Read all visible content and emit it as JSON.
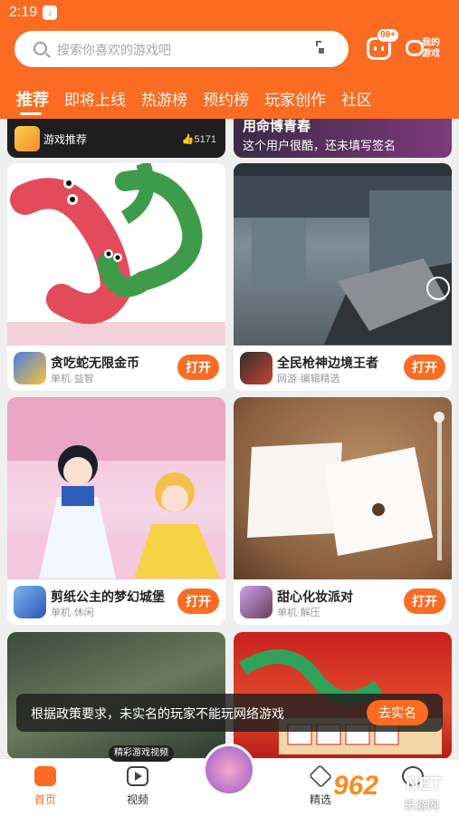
{
  "status": {
    "time": "2:19"
  },
  "search": {
    "placeholder": "搜索你喜欢的游戏吧"
  },
  "header": {
    "message_badge": "99+",
    "my_games_label": "我的游戏"
  },
  "tabs": [
    {
      "label": "推荐",
      "active": true
    },
    {
      "label": "即将上线"
    },
    {
      "label": "热游榜"
    },
    {
      "label": "预约榜"
    },
    {
      "label": "玩家创作"
    },
    {
      "label": "社区"
    }
  ],
  "top_cards": {
    "left": {
      "label": "游戏推荐",
      "likes": "5171"
    },
    "right": {
      "title": "用命博青春",
      "subtitle": "这个用户很酷，还未填写签名"
    }
  },
  "games": [
    {
      "name": "贪吃蛇无限金币",
      "sub": "单机·益智",
      "button": "打开"
    },
    {
      "name": "全民枪神边境王者",
      "sub": "网游·编辑精选",
      "button": "打开"
    },
    {
      "name": "剪纸公主的梦幻城堡",
      "sub": "单机·休闲",
      "button": "打开"
    },
    {
      "name": "甜心化妆派对",
      "sub": "单机·解压",
      "button": "打开"
    }
  ],
  "toast": {
    "text": "根据政策要求，未实名的玩家不能玩网络游戏",
    "button": "去实名"
  },
  "nav": {
    "home": "首页",
    "video": "视频",
    "pick": "精选",
    "video_tag": "精彩游戏视频"
  },
  "watermark": {
    "main": "962",
    "net": "NET",
    "sub": "乐游网"
  },
  "colors": {
    "accent": "#fb6b21"
  }
}
